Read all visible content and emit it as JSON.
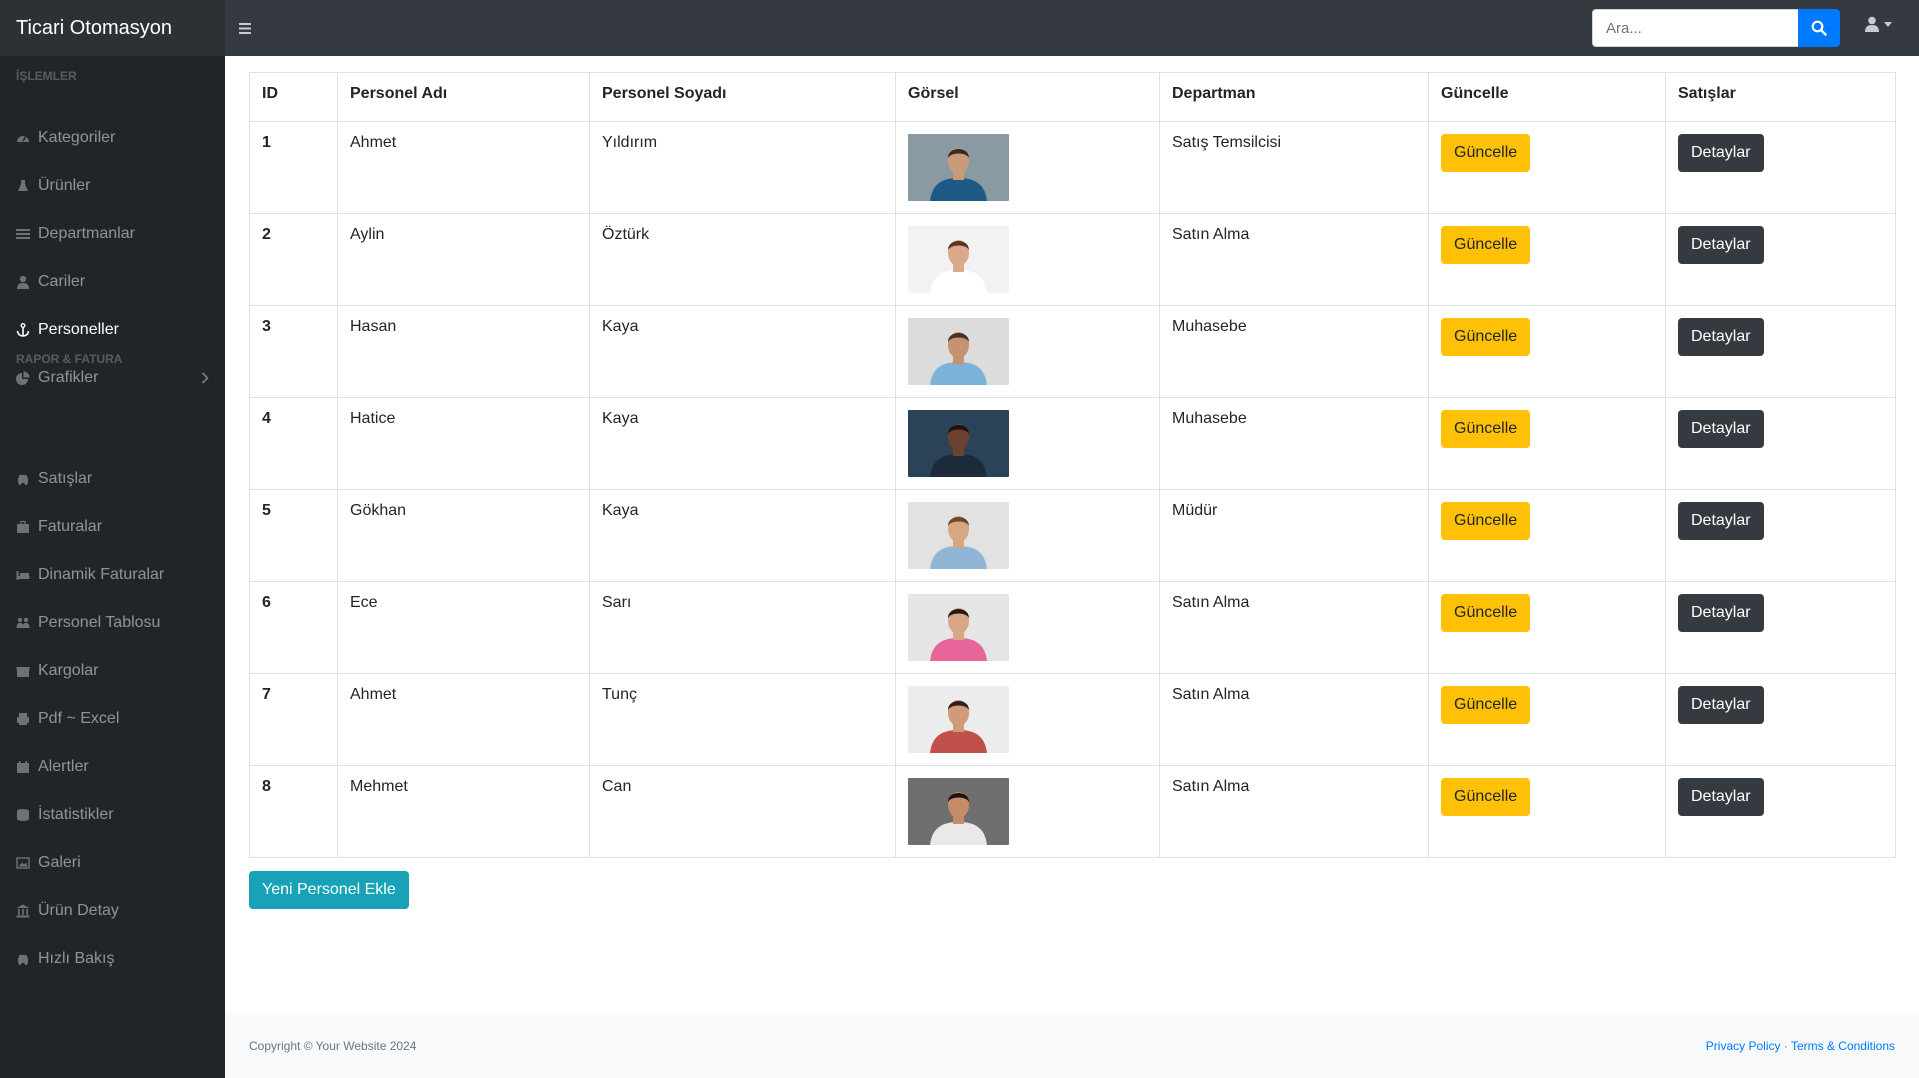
{
  "app": {
    "brand": "Ticari Otomasyon"
  },
  "search": {
    "placeholder": "Ara..."
  },
  "sidebar": {
    "heading1": "İşlemler",
    "items1": [
      {
        "label": "Kategoriler",
        "icon": "tachometer-icon"
      },
      {
        "label": "Ürünler",
        "icon": "flask-icon"
      },
      {
        "label": "Departmanlar",
        "icon": "list-icon"
      },
      {
        "label": "Cariler",
        "icon": "user-icon"
      },
      {
        "label": "Personeller",
        "icon": "anchor-icon",
        "active": true
      },
      {
        "label": "Grafikler",
        "icon": "chart-pie-icon",
        "has_submenu": true
      }
    ],
    "heading2": "Rapor & Fatura",
    "items2": [
      {
        "label": "Satışlar",
        "icon": "car-icon"
      },
      {
        "label": "Faturalar",
        "icon": "briefcase-icon"
      },
      {
        "label": "Dinamik Faturalar",
        "icon": "bed-icon"
      },
      {
        "label": "Personel Tablosu",
        "icon": "users-icon"
      },
      {
        "label": "Kargolar",
        "icon": "gift-icon"
      },
      {
        "label": "Pdf ~ Excel",
        "icon": "print-icon"
      },
      {
        "label": "Alertler",
        "icon": "calendar-icon"
      },
      {
        "label": "İstatistikler",
        "icon": "database-icon"
      },
      {
        "label": "Galeri",
        "icon": "image-icon"
      },
      {
        "label": "Ürün Detay",
        "icon": "bank-icon"
      },
      {
        "label": "Hızlı Bakış",
        "icon": "car-icon"
      }
    ]
  },
  "table": {
    "headers": [
      "ID",
      "Personel Adı",
      "Personel Soyadı",
      "Görsel",
      "Departman",
      "Güncelle",
      "Satışlar"
    ],
    "update_label": "Güncelle",
    "detail_label": "Detaylar",
    "rows": [
      {
        "id": "1",
        "ad": "Ahmet",
        "soyad": "Yıldırım",
        "departman": "Satış Temsilcisi",
        "bg": "#8a9aa3",
        "shirt": "#1f5a86",
        "skin": "#c99a7a",
        "hair": "#3a2a20"
      },
      {
        "id": "2",
        "ad": "Aylin",
        "soyad": "Öztürk",
        "departman": "Satın Alma",
        "bg": "#f2f2f2",
        "shirt": "#ffffff",
        "skin": "#d9a98a",
        "hair": "#5a3522"
      },
      {
        "id": "3",
        "ad": "Hasan",
        "soyad": "Kaya",
        "departman": "Muhasebe",
        "bg": "#dcdcdc",
        "shirt": "#7db3d8",
        "skin": "#c4936f",
        "hair": "#4a3222"
      },
      {
        "id": "4",
        "ad": "Hatice",
        "soyad": "Kaya",
        "departman": "Muhasebe",
        "bg": "#2b4358",
        "shirt": "#1d2a3a",
        "skin": "#6b4330",
        "hair": "#1a1410"
      },
      {
        "id": "5",
        "ad": "Gökhan",
        "soyad": "Kaya",
        "departman": "Müdür",
        "bg": "#e2e2e2",
        "shirt": "#8fb6d6",
        "skin": "#d7a783",
        "hair": "#6b4a2e"
      },
      {
        "id": "6",
        "ad": "Ece",
        "soyad": "Sarı",
        "departman": "Satın Alma",
        "bg": "#e6e6e6",
        "shirt": "#e9669a",
        "skin": "#d8a685",
        "hair": "#2a1a14"
      },
      {
        "id": "7",
        "ad": "Ahmet",
        "soyad": "Tunç",
        "departman": "Satın Alma",
        "bg": "#ececec",
        "shirt": "#c2504a",
        "skin": "#cf9b78",
        "hair": "#2f2018"
      },
      {
        "id": "8",
        "ad": "Mehmet",
        "soyad": "Can",
        "departman": "Satın Alma",
        "bg": "#6f6f6f",
        "shirt": "#e9e9e9",
        "skin": "#c48c68",
        "hair": "#1e1612"
      }
    ]
  },
  "add_button": "Yeni Personel Ekle",
  "footer": {
    "copyright": "Copyright © Your Website 2024",
    "privacy": "Privacy Policy",
    "separator": "·",
    "terms": "Terms & Conditions"
  }
}
